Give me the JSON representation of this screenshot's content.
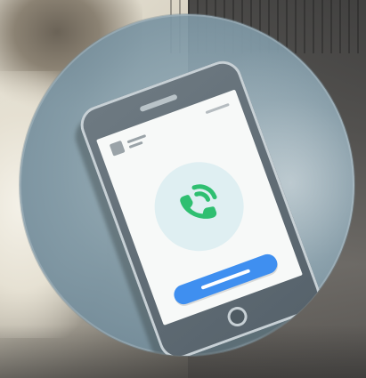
{
  "scene": {
    "description_colors": {
      "circle_tint": "#7e97a4",
      "phone_body": "#56626b",
      "screen": "#f7f9f8",
      "call_accent": "#2fbf71",
      "answer_button": "#3f8ff0"
    },
    "icons": {
      "phone_handset": "phone-handset-icon",
      "signal_waves": "signal-waves-icon"
    }
  }
}
